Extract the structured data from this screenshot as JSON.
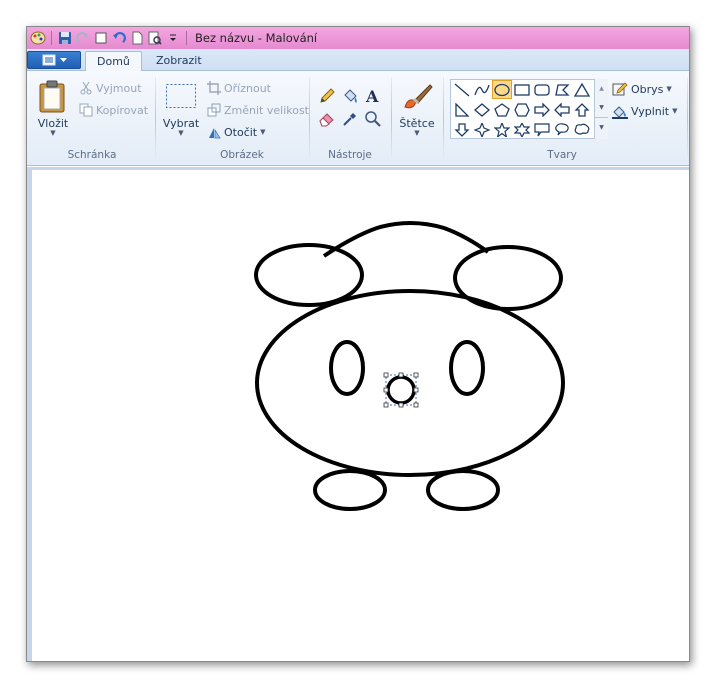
{
  "titlebar": {
    "title": "Bez názvu - Malování"
  },
  "tabs": [
    {
      "label": "Domů"
    },
    {
      "label": "Zobrazit"
    }
  ],
  "clipboard": {
    "paste_label": "Vložit",
    "cut_label": "Vyjmout",
    "copy_label": "Kopírovat",
    "group_label": "Schránka"
  },
  "image": {
    "select_label": "Vybrat",
    "crop_label": "Oříznout",
    "resize_label": "Změnit velikost",
    "rotate_label": "Otočit",
    "group_label": "Obrázek"
  },
  "tools": {
    "group_label": "Nástroje"
  },
  "brushes": {
    "label": "Štětce"
  },
  "shapes": {
    "group_label": "Tvary",
    "outline_label": "Obrys",
    "fill_label": "Vyplnit"
  },
  "colors": {
    "titlebar": "#e58ad1",
    "accent": "#1f5fb4",
    "selected_shape": "#ffd98a"
  }
}
